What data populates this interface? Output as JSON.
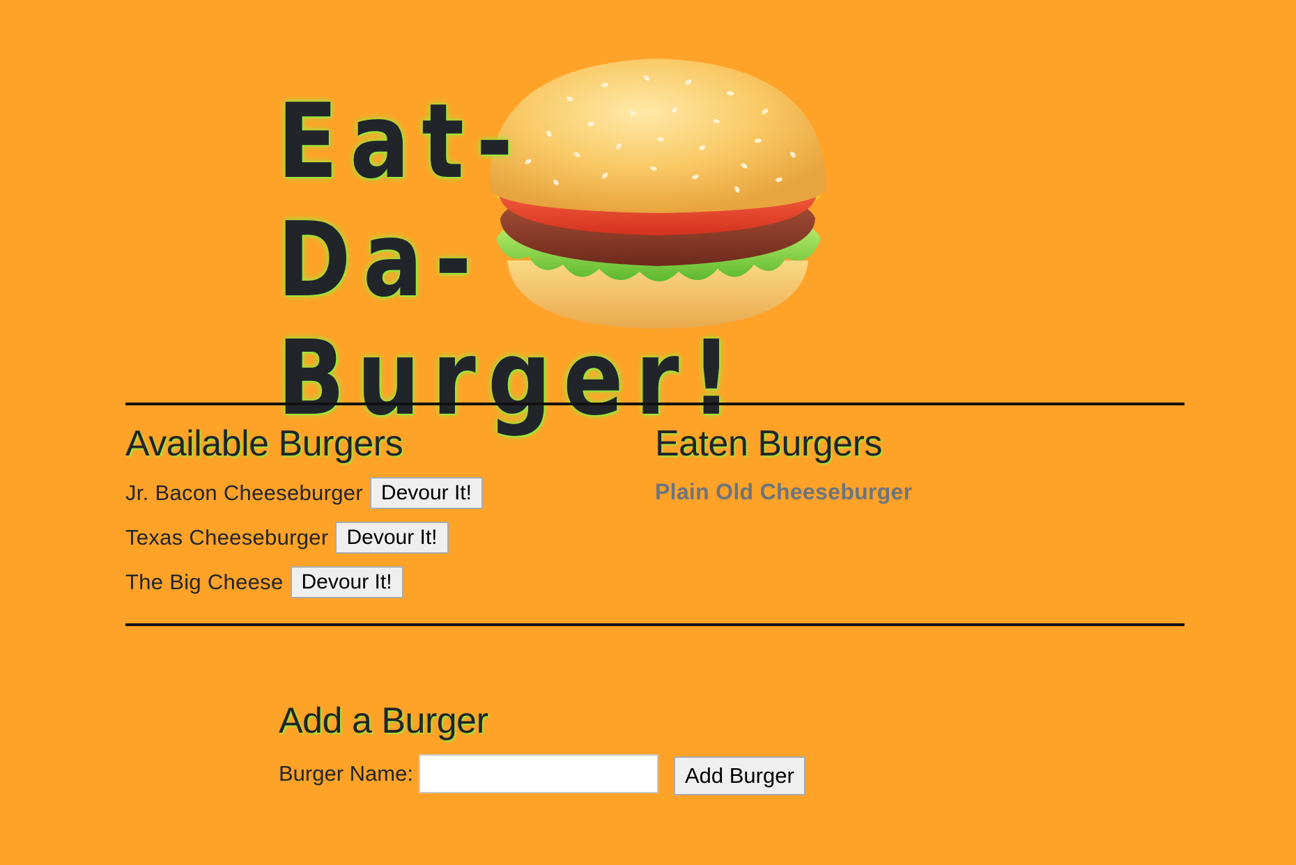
{
  "header": {
    "title_line1": "Eat-Da-",
    "title_line2": "Burger!",
    "logo_icon": "hamburger-icon"
  },
  "available": {
    "heading": "Available Burgers",
    "button_label": "Devour It!",
    "items": [
      {
        "name": "Jr. Bacon Cheeseburger",
        "button": "Devour It!"
      },
      {
        "name": "Texas Cheeseburger",
        "button": "Devour It!"
      },
      {
        "name": "The Big Cheese",
        "button": "Devour It!"
      }
    ]
  },
  "eaten": {
    "heading": "Eaten Burgers",
    "items": [
      {
        "name": "Plain Old Cheeseburger"
      }
    ]
  },
  "add_form": {
    "heading": "Add a Burger",
    "label": "Burger Name:",
    "input_value": "",
    "input_placeholder": "",
    "submit_label": "Add Burger"
  },
  "colors": {
    "background": "#FFA228",
    "heading_glow": "#9CE63C",
    "text": "#212529",
    "eaten_text": "#6C757D"
  }
}
